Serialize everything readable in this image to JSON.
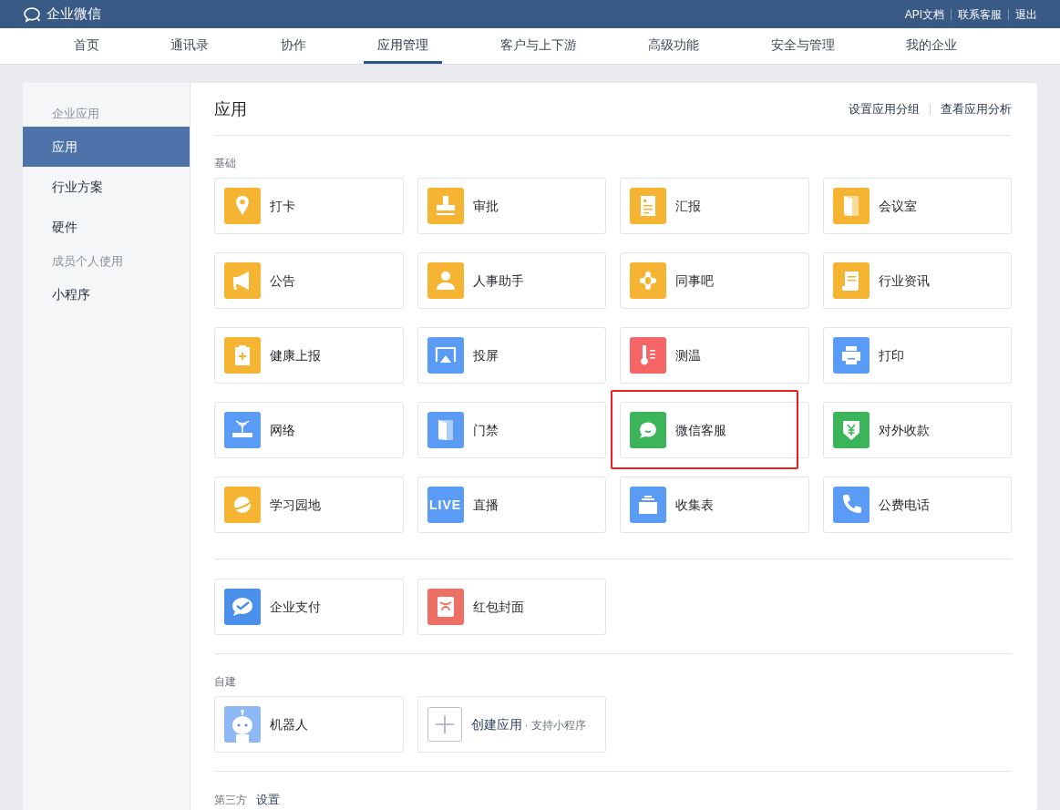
{
  "header": {
    "logo_text": "企业微信",
    "links": [
      "API文档",
      "联系客服",
      "退出"
    ]
  },
  "nav": [
    {
      "label": "首页",
      "selected": false
    },
    {
      "label": "通讯录",
      "selected": false
    },
    {
      "label": "协作",
      "selected": false
    },
    {
      "label": "应用管理",
      "selected": true
    },
    {
      "label": "客户与上下游",
      "selected": false
    },
    {
      "label": "高级功能",
      "selected": false
    },
    {
      "label": "安全与管理",
      "selected": false
    },
    {
      "label": "我的企业",
      "selected": false
    }
  ],
  "sidebar": [
    {
      "kind": "group",
      "label": "企业应用"
    },
    {
      "kind": "item",
      "label": "应用",
      "selected": true
    },
    {
      "kind": "item",
      "label": "行业方案",
      "selected": false
    },
    {
      "kind": "item",
      "label": "硬件",
      "selected": false
    },
    {
      "kind": "group",
      "label": "成员个人使用"
    },
    {
      "kind": "item",
      "label": "小程序",
      "selected": false
    }
  ],
  "main": {
    "title": "应用",
    "actions": [
      "设置应用分组",
      "查看应用分析"
    ],
    "sections": [
      {
        "kind": "apps",
        "title": "基础",
        "groups": [
          [
            {
              "name": "打卡",
              "color": "#f5b532",
              "highlighted": false
            },
            {
              "name": "审批",
              "color": "#f5b532",
              "highlighted": false
            },
            {
              "name": "汇报",
              "color": "#f5b532",
              "highlighted": false
            },
            {
              "name": "会议室",
              "color": "#f5b532",
              "highlighted": false
            },
            {
              "name": "公告",
              "color": "#f5b532",
              "highlighted": false
            },
            {
              "name": "人事助手",
              "color": "#f5b532",
              "highlighted": false
            },
            {
              "name": "同事吧",
              "color": "#f5b532",
              "highlighted": false
            },
            {
              "name": "行业资讯",
              "color": "#f5b532",
              "highlighted": false
            },
            {
              "name": "健康上报",
              "color": "#f5b532",
              "highlighted": false
            },
            {
              "name": "投屏",
              "color": "#5a9cf5",
              "highlighted": false
            },
            {
              "name": "测温",
              "color": "#f56566",
              "highlighted": false
            },
            {
              "name": "打印",
              "color": "#5a9cf5",
              "highlighted": false
            },
            {
              "name": "网络",
              "color": "#5a9cf5",
              "highlighted": false
            },
            {
              "name": "门禁",
              "color": "#5a9cf5",
              "highlighted": false
            },
            {
              "name": "微信客服",
              "color": "#3cb55a",
              "highlighted": true
            },
            {
              "name": "对外收款",
              "color": "#3cb55a",
              "highlighted": false
            },
            {
              "name": "学习园地",
              "color": "#f5b532",
              "highlighted": false
            },
            {
              "icon_text": "LIVE",
              "name": "直播",
              "color": "#5a9cf5",
              "highlighted": false
            },
            {
              "name": "收集表",
              "color": "#5a9cf5",
              "highlighted": false
            },
            {
              "name": "公费电话",
              "color": "#5a9cf5",
              "highlighted": false
            }
          ],
          [
            {
              "name": "企业支付",
              "color": "#4a8fe8",
              "highlighted": false
            },
            {
              "name": "红包封面",
              "color": "#ee6f63",
              "highlighted": false
            }
          ]
        ]
      },
      {
        "kind": "apps",
        "title": "自建",
        "groups": [
          [
            {
              "name": "机器人",
              "color": "#8db8f5",
              "highlighted": false
            }
          ]
        ],
        "create": {
          "label": "创建应用",
          "note": "· 支持小程序"
        }
      },
      {
        "kind": "link",
        "title": "第三方",
        "link": "设置"
      }
    ]
  }
}
